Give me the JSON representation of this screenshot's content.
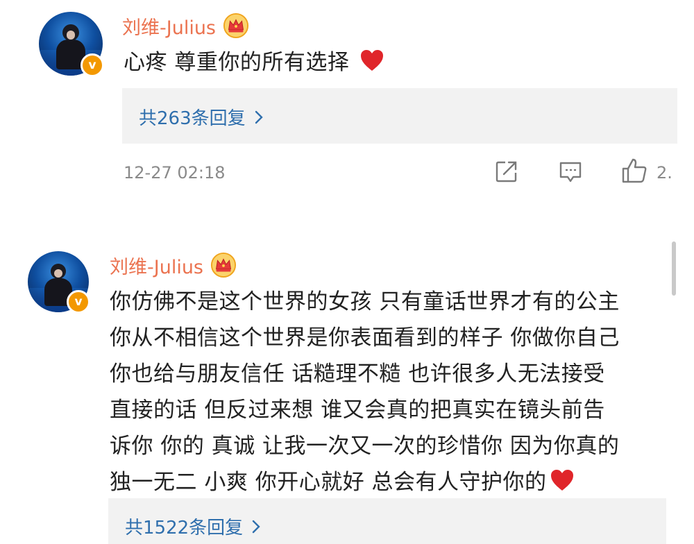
{
  "comments": [
    {
      "username": "刘维-Julius",
      "text_lines": [
        "心疼 尊重你的所有选择"
      ],
      "reply_label": "共263条回复",
      "timestamp": "12-27 02:18",
      "like_count": "2.",
      "verified_badge": "v"
    },
    {
      "username": "刘维-Julius",
      "text_lines": [
        "你仿佛不是这个世界的女孩 只有童话世界才有的公主",
        "你从不相信这个世界是你表面看到的样子 你做你自己",
        "你也给与朋友信任 话糙理不糙 也许很多人无法接受",
        "直接的话 但反过来想 谁又会真的把真实在镜头前告",
        "诉你 你的 真诚 让我一次又一次的珍惜你 因为你真的",
        "独一无二 小爽 你开心就好 总会有人守护你的"
      ],
      "reply_label": "共1522条回复",
      "verified_badge": "v"
    }
  ],
  "icons": {
    "crown": "crown-icon",
    "heart": "heart-icon",
    "share": "share-icon",
    "comment": "comment-icon",
    "like": "like-icon",
    "chevron": "chevron-right-icon"
  },
  "colors": {
    "username": "#eb7350",
    "reply_link": "#2f6fad",
    "reply_bg": "#f2f2f2",
    "meta": "#8a8a8a",
    "heart": "#e0252a",
    "badge": "#f39800"
  }
}
